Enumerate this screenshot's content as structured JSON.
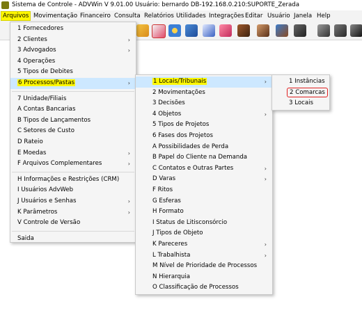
{
  "window": {
    "title": "Sistema de Controle - ADVWin  V 9.01.00  Usuário: bernardo  DB-192.168.0.210:SUPORTE_Zerada"
  },
  "menubar": [
    "Arquivos",
    "Movimentação",
    "Financeiro",
    "Consulta",
    "Relatórios",
    "Utilidades",
    "Integrações",
    "Editar",
    "Usuário",
    "Janela",
    "Help"
  ],
  "menu_arquivos": [
    "1 Fornecedores",
    "2 Clientes",
    "3 Advogados",
    "4 Operações",
    "5 Tipos de Debites",
    "6 Processos/Pastas",
    "7 Unidade/Filiais",
    "A Contas Bancarias",
    "B Tipos de Lançamentos",
    "C Setores de Custo",
    "D Rateio",
    "E Moedas",
    "F Arquivos Complementares",
    "H Informações e Restrições (CRM)",
    "I Usuários AdvWeb",
    "J Usuários e Senhas",
    "K Parâmetros",
    "V Controle de Versão",
    "Saida"
  ],
  "menu_processos": [
    "1 Locais/Tribunais",
    "2 Movimentações",
    "3 Decisões",
    "4 Objetos",
    "5 Tipos de Projetos",
    "6 Fases dos Projetos",
    "A Possibilidades de Perda",
    "B Papel do Cliente na Demanda",
    "C Contatos e Outras Partes",
    "D Varas",
    "F Ritos",
    "G Esferas",
    "H Formato",
    "I Status de Litisconsórcio",
    "J Tipos de Objeto",
    "K Pareceres",
    "L Trabalhista",
    "M Nível de Prioridade de Processos",
    "N Hierarquia",
    "O Classificação de Processos"
  ],
  "menu_locais": [
    "1 Instâncias",
    "2 Comarcas",
    "3 Locais"
  ]
}
